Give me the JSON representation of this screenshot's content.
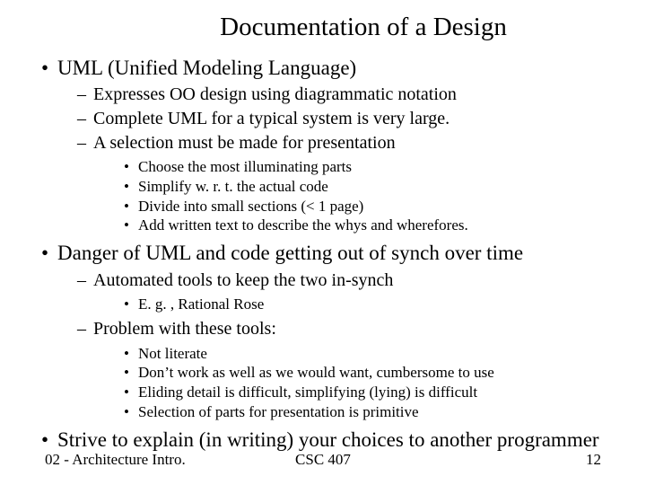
{
  "title": "Documentation of a Design",
  "bullets": {
    "b1": "UML (Unified Modeling Language)",
    "b1_1": "Expresses OO design using diagrammatic notation",
    "b1_2": "Complete UML for a typical system is very large.",
    "b1_3": "A selection must be made for presentation",
    "b1_3_1": "Choose the most illuminating parts",
    "b1_3_2": "Simplify w. r. t. the actual code",
    "b1_3_3": "Divide into small sections (< 1 page)",
    "b1_3_4": "Add written text to describe the whys and wherefores.",
    "b2": "Danger of UML and code getting out of synch over time",
    "b2_1": "Automated tools to keep the two in-synch",
    "b2_1_1": "E. g. , Rational Rose",
    "b2_2": "Problem with these tools:",
    "b2_2_1": "Not literate",
    "b2_2_2": "Don’t work as well as we would want, cumbersome to use",
    "b2_2_3": "Eliding detail is difficult, simplifying (lying) is difficult",
    "b2_2_4": "Selection of parts for presentation is primitive",
    "b3": "Strive to explain (in writing) your choices to another programmer"
  },
  "footer": {
    "left": "02 - Architecture Intro.",
    "center": "CSC 407",
    "right": "12"
  }
}
